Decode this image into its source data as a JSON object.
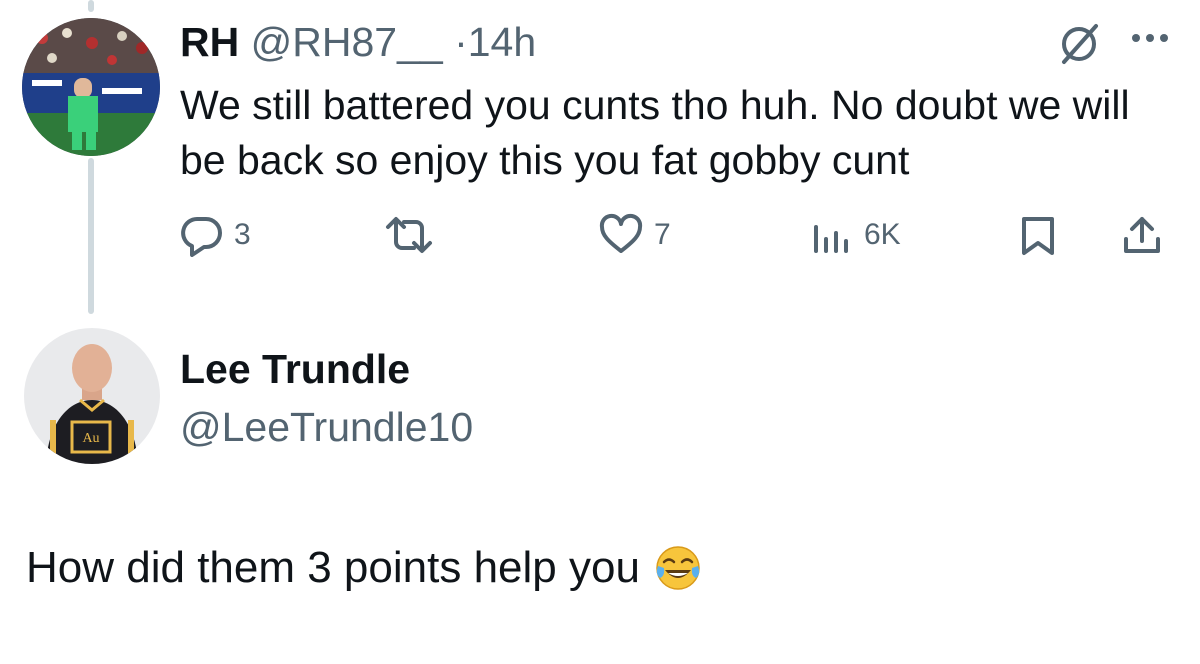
{
  "parent_tweet": {
    "display_name": "RH",
    "handle": "@RH87__",
    "separator": "·",
    "time": "14h",
    "text": "We still battered you cunts tho huh. No doubt we will be back so enjoy this you fat gobby cunt",
    "actions": {
      "replies": "3",
      "likes": "7",
      "views": "6K"
    },
    "icons": [
      "grok-icon",
      "more-icon",
      "reply-icon",
      "retweet-icon",
      "like-icon",
      "views-icon",
      "bookmark-icon",
      "share-icon"
    ]
  },
  "reply_tweet": {
    "display_name": "Lee Trundle",
    "handle": "@LeeTrundle10",
    "text": "How did them 3 points help you",
    "emoji": "face-with-tears-of-joy"
  },
  "colors": {
    "text": "#0f1419",
    "secondary": "#536471",
    "thread_line": "#cfd9de"
  }
}
